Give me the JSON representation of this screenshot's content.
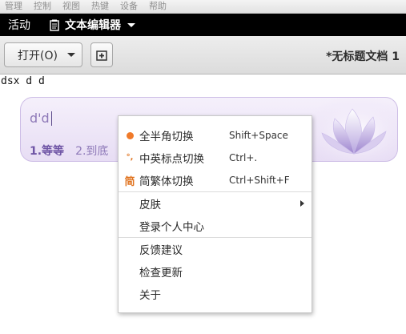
{
  "vm_menubar": {
    "items": [
      "管理",
      "控制",
      "视图",
      "热键",
      "设备",
      "帮助"
    ]
  },
  "topbar": {
    "activities": "活动",
    "app_name": "文本编辑器",
    "app_icon": "text-editor-icon"
  },
  "headerbar": {
    "open_label": "打开(O)",
    "new_document_icon": "new-document-icon",
    "title": "*无标题文档 1"
  },
  "editor": {
    "line1": "dsx d d"
  },
  "ime": {
    "preedit": "d'd",
    "candidates": [
      "1.等等",
      "2.到底"
    ]
  },
  "context_menu": {
    "items": [
      {
        "label": "全半角切换",
        "accel": "Shift+Space",
        "icon": "full-half-width-icon"
      },
      {
        "label": "中英标点切换",
        "accel": "Ctrl+.",
        "icon": "punctuation-icon"
      },
      {
        "label": "简繁体切换",
        "accel": "Ctrl+Shift+F",
        "icon": "simplified-traditional-icon",
        "icon_glyph": "简"
      },
      {
        "label": "皮肤",
        "submenu": true
      },
      {
        "label": "登录个人中心"
      },
      {
        "label": "反馈建议"
      },
      {
        "label": "检查更新"
      },
      {
        "label": "关于"
      }
    ]
  },
  "colors": {
    "topbar_bg": "#000000",
    "ime_accent": "#6f55a5",
    "menu_icon_orange": "#f07a2a"
  }
}
